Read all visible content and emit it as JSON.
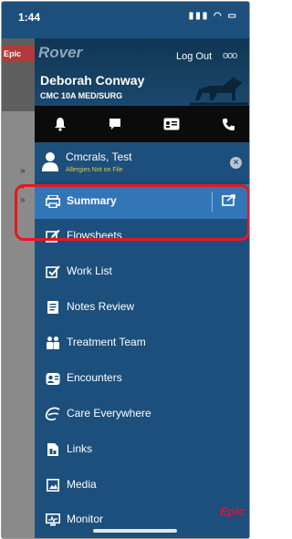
{
  "status_bar": {
    "time": "1:44",
    "signal": "▮▮▮ ◠ ▭"
  },
  "background": {
    "brand": "Epic"
  },
  "header": {
    "logo": "Rover",
    "logout_label": "Log Out",
    "more_label": "ooo",
    "user_name": "Deborah Conway",
    "department": "CMC 10A MED/SURG"
  },
  "toolbar": {
    "icons": [
      "bell-icon",
      "chat-icon",
      "id-card-icon",
      "phone-icon"
    ]
  },
  "patient": {
    "name": "Cmcrals, Test",
    "allergies": "Allergies Not on File"
  },
  "menu": {
    "items": [
      {
        "label": "Summary",
        "icon": "printer-icon",
        "active": true
      },
      {
        "label": "Flowsheets",
        "icon": "pencil-icon",
        "highlighted": true
      },
      {
        "label": "Work List",
        "icon": "checkbox-icon"
      },
      {
        "label": "Notes Review",
        "icon": "note-icon"
      },
      {
        "label": "Treatment Team",
        "icon": "team-icon"
      },
      {
        "label": "Encounters",
        "icon": "encounters-icon"
      },
      {
        "label": "Care Everywhere",
        "icon": "care-everywhere-icon"
      },
      {
        "label": "Links",
        "icon": "link-icon"
      },
      {
        "label": "Media",
        "icon": "image-icon"
      },
      {
        "label": "Monitor",
        "icon": "monitor-icon"
      }
    ]
  },
  "footer": {
    "brand": "Epic"
  },
  "colors": {
    "panel": "#1c4f7c",
    "active_item": "#3276b8",
    "highlight_box": "#e8171d",
    "epic_red": "#d4163c",
    "allergy_text": "#e6c640"
  }
}
